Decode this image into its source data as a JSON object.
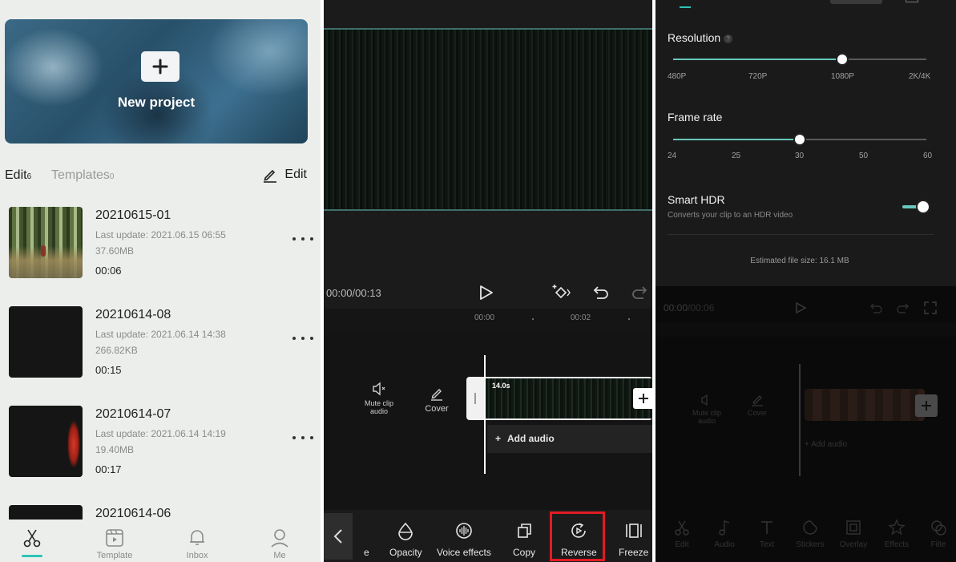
{
  "projects_screen": {
    "new_project_label": "New project",
    "tabs": {
      "edit_label": "Edit",
      "edit_count": "6",
      "templates_label": "Templates",
      "templates_count": "0"
    },
    "edit_button_label": "Edit",
    "projects": [
      {
        "title": "20210615-01",
        "last_update": "Last update: 2021.06.15 06:55",
        "size": "37.60MB",
        "duration": "00:06"
      },
      {
        "title": "20210614-08",
        "last_update": "Last update: 2021.06.14 14:38",
        "size": "266.82KB",
        "duration": "00:15"
      },
      {
        "title": "20210614-07",
        "last_update": "Last update: 2021.06.14 14:19",
        "size": "19.40MB",
        "duration": "00:17"
      },
      {
        "title": "20210614-06"
      }
    ],
    "bottom_nav": [
      {
        "label": "",
        "icon": "scissors-icon"
      },
      {
        "label": "Template",
        "icon": "template-icon"
      },
      {
        "label": "Inbox",
        "icon": "bell-icon"
      },
      {
        "label": "Me",
        "icon": "person-icon"
      }
    ],
    "accent_color": "#2dc4b6"
  },
  "editor_screen": {
    "timecode": "00:00/00:13",
    "ruler": [
      "00:00",
      "00:02"
    ],
    "clip_duration": "14.0s",
    "mute_label": "Mute clip audio",
    "cover_label": "Cover",
    "add_audio_label": "Add audio",
    "tools": [
      {
        "label": "e",
        "icon": "partial-tool"
      },
      {
        "label": "Opacity",
        "icon": "opacity-icon"
      },
      {
        "label": "Voice effects",
        "icon": "voice-effects-icon"
      },
      {
        "label": "Copy",
        "icon": "copy-icon"
      },
      {
        "label": "Reverse",
        "icon": "reverse-icon",
        "highlighted": true
      },
      {
        "label": "Freeze",
        "icon": "freeze-icon"
      }
    ],
    "highlight_color": "#e31b23"
  },
  "export_screen": {
    "resolution": {
      "label": "Resolution",
      "help": "?",
      "options": [
        "480P",
        "720P",
        "1080P",
        "2K/4K"
      ],
      "selected": "1080P",
      "selected_index": 2
    },
    "frame_rate": {
      "label": "Frame rate",
      "options": [
        "24",
        "25",
        "30",
        "50",
        "60"
      ],
      "selected": "30",
      "selected_index": 2
    },
    "smart_hdr": {
      "label": "Smart HDR",
      "subtitle": "Converts your clip to an HDR video",
      "enabled": true
    },
    "estimated_size": "Estimated file size: 16.1 MB",
    "background_editor": {
      "timecode_current": "00:00",
      "timecode_total": "/00:06",
      "mute_label": "Mute clip audio",
      "cover_label": "Cover",
      "add_audio_label": "+ Add audio",
      "tools": [
        "Edit",
        "Audio",
        "Text",
        "Stickers",
        "Overlay",
        "Effects",
        "Filte"
      ]
    },
    "accent_color": "#68c7bd"
  }
}
